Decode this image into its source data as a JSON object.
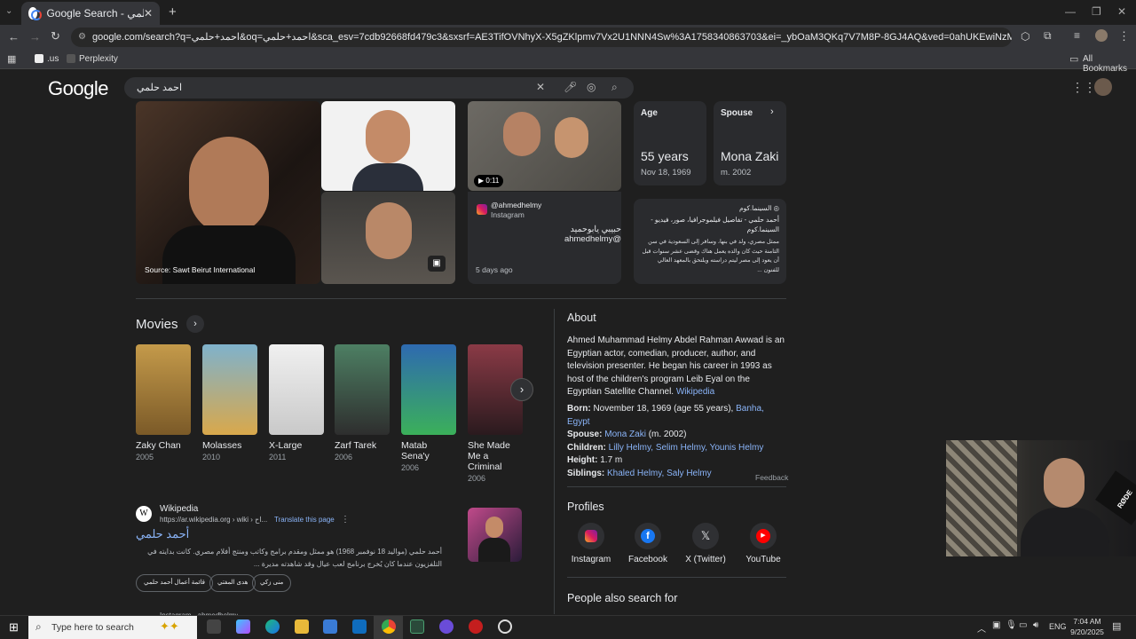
{
  "browser": {
    "tab_title": "Google Search - احمد حلمي",
    "url": "google.com/search?q=احمد+حلمي&oq=احمد+حلمي&sca_esv=7cdb92668fd479c3&sxsrf=AE3TifOVNhyX-X5gZKlpmv7Vx2U1NNN4Sw%3A1758340863703&ei=_ybOaM3QKq7V7M8P-8GJ4AQ&ved=0ahUKEwiNzMyUuuaPAxWuKvsDHftgAkwQ4dUDCBA&uact=5...",
    "bookmarks": [
      ".us",
      "Perplexity"
    ],
    "all_bookmarks": "All Bookmarks"
  },
  "google": {
    "logo": "Google",
    "query": "احمد حلمي"
  },
  "images": {
    "source": "Source: Sawt Beirut International",
    "video_duration": "0:11",
    "insta_handle": "@ahmedhelmy",
    "insta_platform": "Instagram",
    "insta_caption": "حبيبي يابوحميد @ahmedhelmy",
    "insta_age": "5 days ago"
  },
  "facts": {
    "age_label": "Age",
    "age_value": "55 years",
    "age_sub": "Nov 18, 1969",
    "spouse_label": "Spouse",
    "spouse_value": "Mona Zaki",
    "spouse_sub": "m. 2002"
  },
  "elcinema": {
    "site": "السينما.كوم",
    "title": "أحمد حلمي - تفاصيل فيلموجرافيا، صور، فيديو - السينما.كوم",
    "snippet": "ممثل مصري، ولد في بنها، وسافر إلى السعودية في سن الثامنة حيث كان والده يعمل هناك وقضى عشر سنوات قبل أن يعود إلى مصر ليتم دراسته ويلتحق بالمعهد العالي للفنون ..."
  },
  "movies": {
    "heading": "Movies",
    "items": [
      {
        "title": "Zaky Chan",
        "year": "2005",
        "color": "#b58a3a"
      },
      {
        "title": "Molasses",
        "year": "2010",
        "color": "#6a9ab4"
      },
      {
        "title": "X-Large",
        "year": "2011",
        "color": "#dcdcdc"
      },
      {
        "title": "Zarf Tarek",
        "year": "2006",
        "color": "#3f6e5a"
      },
      {
        "title": "Matab Sena'y",
        "year": "2006",
        "color": "#2e6ab0"
      },
      {
        "title": "She Made Me a Criminal",
        "year": "2006",
        "color": "#7a2f3a"
      }
    ]
  },
  "about": {
    "heading": "About",
    "text": "Ahmed Muhammad Helmy Abdel Rahman Awwad is an Egyptian actor, comedian, producer, author, and television presenter. He began his career in 1993 as host of the children's program Leib Eyal on the Egyptian Satellite Channel.",
    "wiki": "Wikipedia",
    "born_label": "Born:",
    "born_value": "November 18, 1969 (age 55 years),",
    "born_place": "Banha, Egypt",
    "spouse_label": "Spouse:",
    "spouse_value": "Mona Zaki",
    "spouse_sub": "(m. 2002)",
    "children_label": "Children:",
    "children_value": "Lilly Helmy, Selim Helmy, Younis Helmy",
    "height_label": "Height:",
    "height_value": "1.7 m",
    "siblings_label": "Siblings:",
    "siblings_value": "Khaled Helmy, Saly Helmy",
    "feedback": "Feedback"
  },
  "profiles": {
    "heading": "Profiles",
    "items": [
      "Instagram",
      "Facebook",
      "X (Twitter)",
      "YouTube"
    ]
  },
  "people_also": "People also search for",
  "wikipedia_result": {
    "site": "Wikipedia",
    "crumb": "https://ar.wikipedia.org › wiki › اح...",
    "translate": "Translate this page",
    "title": "أحمد حلمي",
    "snippet": "أحمد حلمي (مواليد 18 نوفمبر 1968) هو ممثل ومقدم برامج وكاتب ومنتج أفلام مصري. كانت بدايته في التلفزيون عندما كان يُخرج برنامج لعب عيال وقد شاهدته مديرة ...",
    "chips": [
      "قائمة أعمال أحمد حلمي",
      "هدى المفتي",
      "منى زكي"
    ],
    "next_site": "Instagram · ahmedhelmy"
  },
  "taskbar": {
    "search": "Type here to search",
    "lang": "ENG",
    "time": "7:04 AM",
    "date": "9/20/2025"
  },
  "overlay": {
    "mic_brand": "RØDE"
  }
}
